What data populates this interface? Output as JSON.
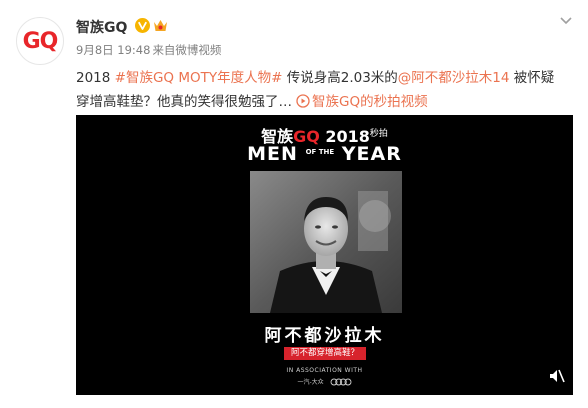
{
  "post": {
    "avatar_logo": "GQ",
    "username": "智族GQ",
    "verified_icon": "verified-v-icon",
    "vip_icon": "vip-badge-icon",
    "time": "9月8日 19:48",
    "source": "来自微博视频",
    "text": {
      "prefix": "2018 ",
      "hashtag": "#智族GQ MOTY年度人物#",
      "middle": " 传说身高2.03米的",
      "mention": "@阿不都沙拉木14",
      "suffix": " 被怀疑穿增高鞋垫？他真的笑得很勉强了…",
      "link_label": "智族GQ的秒拍视频"
    },
    "accent_color": "#eb7350"
  },
  "video": {
    "brand_cn": "智族",
    "brand_gq": "GQ",
    "year": "2018",
    "brand_small": "秒拍",
    "moty_men": "MEN",
    "moty_of_the": "OF THE",
    "moty_year": "YEAR",
    "name": "阿不都沙拉木",
    "tag": "阿不都穿增高鞋？",
    "assoc": "IN ASSOCIATION WITH",
    "sponsor": "一汽-大众",
    "mute_icon": "mute-icon"
  }
}
